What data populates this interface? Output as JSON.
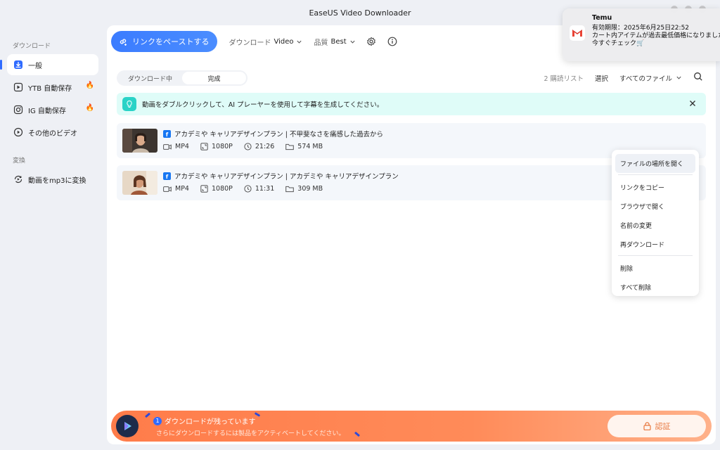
{
  "window": {
    "title": "EaseUS Video Downloader"
  },
  "sidebar": {
    "section_download": "ダウンロード",
    "items": [
      {
        "label": "一般",
        "icon": "download-icon",
        "active": true
      },
      {
        "label": "YTB 自動保存",
        "icon": "play-icon",
        "hot": true
      },
      {
        "label": "IG 自動保存",
        "icon": "instagram-icon",
        "hot": true
      },
      {
        "label": "その他のビデオ",
        "icon": "circle-play-icon"
      }
    ],
    "section_convert": "変換",
    "convert_items": [
      {
        "label": "動画をmp3に変換",
        "icon": "convert-icon"
      }
    ],
    "hot_glyph": "🔥"
  },
  "toolbar": {
    "paste_label": "リンクをペーストする",
    "download_label": "ダウンロード",
    "download_value": "Video",
    "quality_label": "品質",
    "quality_value": "Best"
  },
  "tabs": {
    "downloading": "ダウンロード中",
    "completed": "完成"
  },
  "list_bar": {
    "watch_list": "2 購読リスト",
    "select": "選択",
    "all_files": "すべてのファイル"
  },
  "banner": {
    "text": "動画をダブルクリックして、AI プレーヤーを使用して字幕を生成してください。"
  },
  "videos": [
    {
      "title": "アカデミや キャリアデザインプラン | 不甲斐なさを痛感した過去から",
      "format": "MP4",
      "resolution": "1080P",
      "duration": "21:26",
      "size": "574 MB"
    },
    {
      "title": "アカデミや キャリアデザインプラン | アカデミや キャリアデザインプラン",
      "format": "MP4",
      "resolution": "1080P",
      "duration": "11:31",
      "size": "309 MB"
    }
  ],
  "context_menu": {
    "open_location": "ファイルの場所を開く",
    "copy_link": "リンクをコピー",
    "open_browser": "ブラウザで開く",
    "rename": "名前の変更",
    "redownload": "再ダウンロード",
    "delete": "削除",
    "delete_all": "すべて削除"
  },
  "bottom_bar": {
    "count": "1",
    "remaining": "ダウンロードが残っています",
    "hint": "さらにダウンロードするには製品をアクティベートしてください。",
    "auth": "認証"
  },
  "notification": {
    "app": "Temu",
    "line1": "有効期限：2025年6月25日22:52",
    "line2": "カート内アイテムが過去最低価格になりました！",
    "line3": "今すぐチェック🛒"
  },
  "colors": {
    "accent": "#2f6bff",
    "banner_bg": "#dffcf8",
    "bottom_bar": "#ff8b59"
  }
}
